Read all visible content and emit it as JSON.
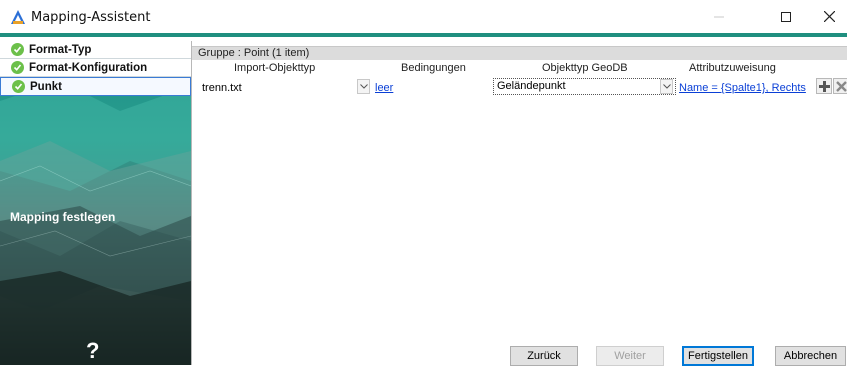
{
  "window": {
    "title": "Mapping-Assistent",
    "accent": "#1f8f7f"
  },
  "steps": [
    {
      "label": "Format-Typ",
      "done": true
    },
    {
      "label": "Format-Konfiguration",
      "done": true
    },
    {
      "label": "Punkt",
      "done": true,
      "active": true
    }
  ],
  "sidebar": {
    "caption": "Mapping festlegen",
    "help": "?"
  },
  "group": {
    "header": "Gruppe : Point (1 item)"
  },
  "columns": [
    "Import-Objekttyp",
    "Bedingungen",
    "Objekttyp GeoDB",
    "Attributzuweisung"
  ],
  "row": {
    "import_type": "trenn.txt",
    "condition": "leer",
    "geodb_type": "Geländepunkt",
    "attribute": "Name = {Spalte1}, Rechts"
  },
  "footer": {
    "back": "Zurück",
    "next": "Weiter",
    "finish": "Fertigstellen",
    "cancel": "Abbrechen"
  }
}
